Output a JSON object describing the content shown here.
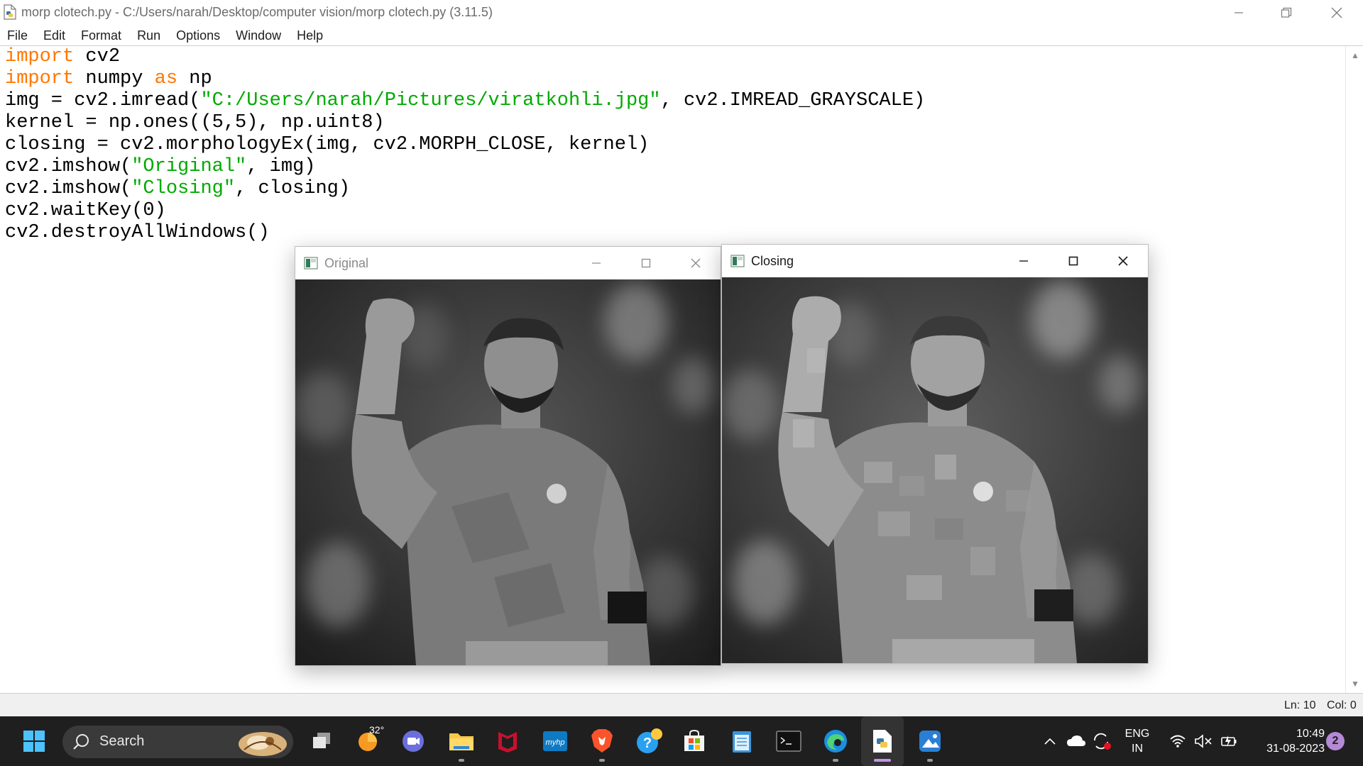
{
  "window": {
    "title": "morp clotech.py - C:/Users/narah/Desktop/computer vision/morp clotech.py (3.11.5)"
  },
  "menu": {
    "items": [
      "File",
      "Edit",
      "Format",
      "Run",
      "Options",
      "Window",
      "Help"
    ]
  },
  "code": {
    "lines": [
      [
        {
          "t": "import",
          "c": "kw"
        },
        {
          "t": " cv2",
          "c": ""
        }
      ],
      [
        {
          "t": "import",
          "c": "kw"
        },
        {
          "t": " numpy ",
          "c": ""
        },
        {
          "t": "as",
          "c": "kw"
        },
        {
          "t": " np",
          "c": ""
        }
      ],
      [
        {
          "t": "img = cv2.imread(",
          "c": ""
        },
        {
          "t": "\"C:/Users/narah/Pictures/viratkohli.jpg\"",
          "c": "str"
        },
        {
          "t": ", cv2.IMREAD_GRAYSCALE)",
          "c": ""
        }
      ],
      [
        {
          "t": "kernel = np.ones((5,5), np.uint8)",
          "c": ""
        }
      ],
      [
        {
          "t": "closing = cv2.morphologyEx(img, cv2.MORPH_CLOSE, kernel)",
          "c": ""
        }
      ],
      [
        {
          "t": "cv2.imshow(",
          "c": ""
        },
        {
          "t": "\"Original\"",
          "c": "str"
        },
        {
          "t": ", img)",
          "c": ""
        }
      ],
      [
        {
          "t": "cv2.imshow(",
          "c": ""
        },
        {
          "t": "\"Closing\"",
          "c": "str"
        },
        {
          "t": ", closing)",
          "c": ""
        }
      ],
      [
        {
          "t": "cv2.waitKey(0)",
          "c": ""
        }
      ],
      [
        {
          "t": "cv2.destroyAllWindows()",
          "c": ""
        }
      ]
    ]
  },
  "status": {
    "line": "Ln: 10",
    "column": "Col: 0"
  },
  "image_windows": {
    "original": {
      "title": "Original"
    },
    "closing": {
      "title": "Closing"
    }
  },
  "taskbar": {
    "search_placeholder": "Search",
    "weather_temp": "32°",
    "apps": [
      {
        "name": "start-button",
        "icon": "windows-logo-icon"
      },
      {
        "name": "task-view-button",
        "icon": "task-view-icon"
      },
      {
        "name": "weather-widget",
        "icon": "weather-sun-icon"
      },
      {
        "name": "teams-chat",
        "icon": "chat-icon"
      },
      {
        "name": "file-explorer",
        "icon": "folder-icon"
      },
      {
        "name": "mcafee",
        "icon": "mcafee-icon"
      },
      {
        "name": "myhp",
        "icon": "myhp-icon"
      },
      {
        "name": "brave-browser",
        "icon": "brave-icon"
      },
      {
        "name": "get-help",
        "icon": "help-icon"
      },
      {
        "name": "microsoft-store",
        "icon": "store-icon"
      },
      {
        "name": "notepad",
        "icon": "notepad-icon"
      },
      {
        "name": "terminal",
        "icon": "terminal-icon"
      },
      {
        "name": "edge-browser",
        "icon": "edge-icon"
      },
      {
        "name": "python-idle",
        "icon": "python-idle-icon"
      },
      {
        "name": "photos",
        "icon": "photos-icon"
      }
    ],
    "tray": {
      "lang_top": "ENG",
      "lang_bottom": "IN",
      "time": "10:49",
      "date": "31-08-2023",
      "notification_count": "2"
    }
  },
  "colors": {
    "keyword": "#ff7700",
    "string": "#00aa00",
    "taskbar_bg": "#1f1f1f",
    "active_indicator": "#c792ea"
  }
}
